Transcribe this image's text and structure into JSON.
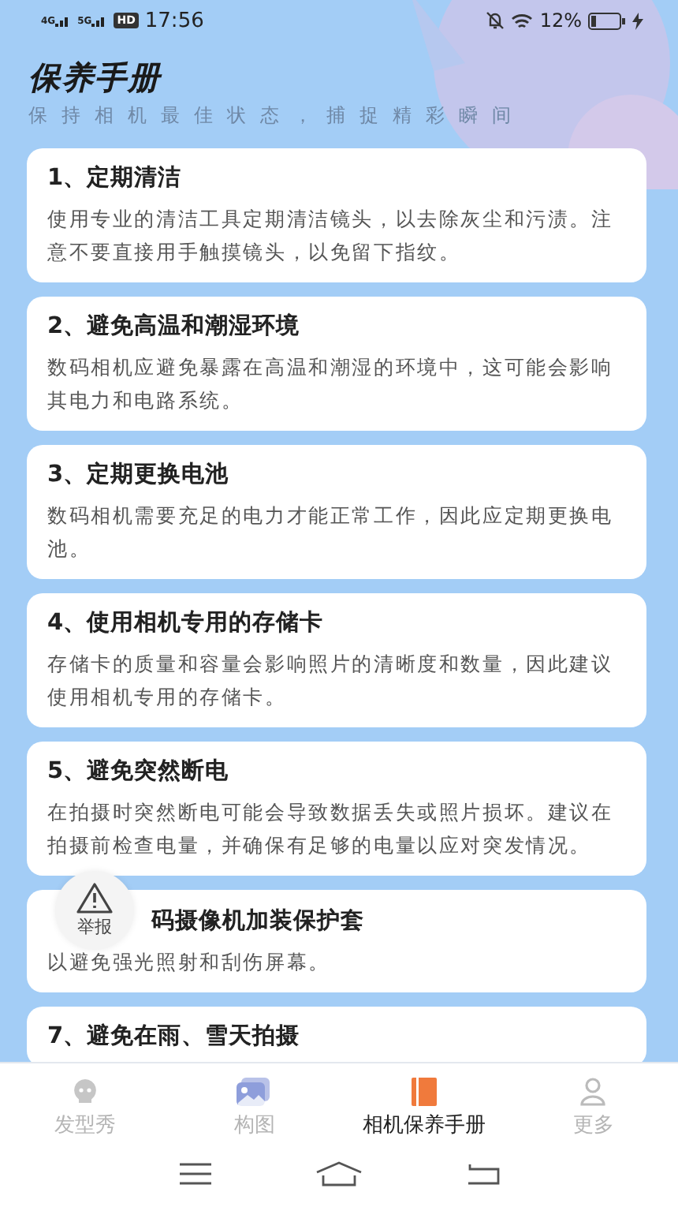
{
  "status_bar": {
    "networks": [
      "4G",
      "5G"
    ],
    "hd": "HD",
    "time": "17:56",
    "battery": "12%"
  },
  "header": {
    "title": "保养手册",
    "subtitle": "保持相机最佳状态，捕捉精彩瞬间"
  },
  "cards": [
    {
      "title": "1、定期清洁",
      "body": "使用专业的清洁工具定期清洁镜头，以去除灰尘和污渍。注意不要直接用手触摸镜头，以免留下指纹。"
    },
    {
      "title": "2、避免高温和潮湿环境",
      "body": "数码相机应避免暴露在高温和潮湿的环境中，这可能会影响其电力和电路系统。"
    },
    {
      "title": "3、定期更换电池",
      "body": "数码相机需要充足的电力才能正常工作，因此应定期更换电池。"
    },
    {
      "title": "4、使用相机专用的存储卡",
      "body": "存储卡的质量和容量会影响照片的清晰度和数量，因此建议使用相机专用的存储卡。"
    },
    {
      "title": "5、避免突然断电",
      "body": "在拍摄时突然断电可能会导致数据丢失或照片损坏。建议在拍摄前检查电量，并确保有足够的电量以应对突发情况。"
    },
    {
      "title": "码摄像机加装保护套",
      "body": "以避免强光照射和刮伤屏幕。",
      "report": {
        "label": "举报"
      }
    },
    {
      "title": "7、避免在雨、雪天拍摄"
    }
  ],
  "tabs": [
    {
      "label": "发型秀",
      "kind": "face",
      "selected": false
    },
    {
      "label": "构图",
      "kind": "photo",
      "selected": false
    },
    {
      "label": "相机保养手册",
      "kind": "book",
      "selected": true
    },
    {
      "label": "更多",
      "kind": "person",
      "selected": false
    }
  ]
}
